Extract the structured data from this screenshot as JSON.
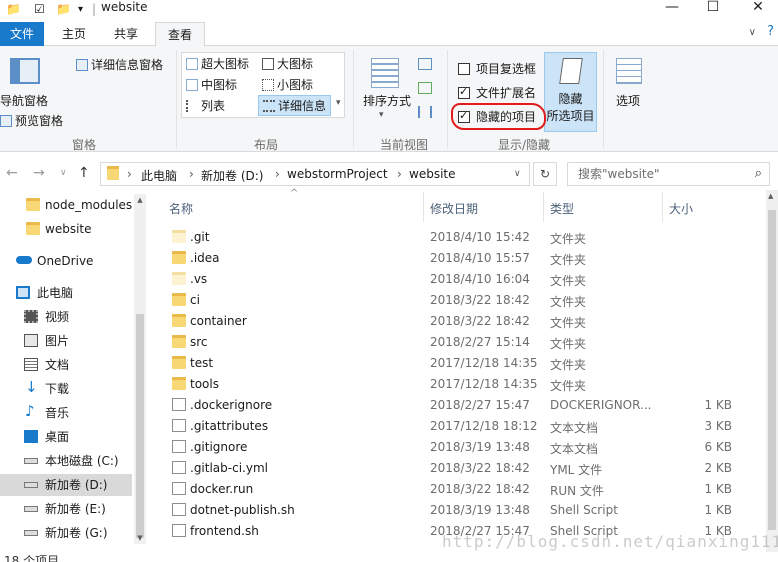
{
  "window": {
    "title": "website",
    "minimize": "—",
    "maximize": "☐",
    "close": "✕"
  },
  "tabs": [
    "文件",
    "主页",
    "共享",
    "查看"
  ],
  "ribbon": {
    "panes": {
      "nav_pane": "导航窗格",
      "preview_pane": "预览窗格",
      "details_pane": "详细信息窗格",
      "group": "窗格"
    },
    "layout": {
      "items": [
        "超大图标",
        "大图标",
        "中图标",
        "小图标",
        "列表",
        "详细信息"
      ],
      "group": "布局"
    },
    "current_view": {
      "sort_by": "排序方式",
      "group": "当前视图"
    },
    "show_hide": {
      "item_checkboxes": {
        "label": "项目复选框",
        "checked": false
      },
      "file_extensions": {
        "label": "文件扩展名",
        "checked": true
      },
      "hidden_items": {
        "label": "隐藏的项目",
        "checked": true
      },
      "hide_selected_line1": "隐藏",
      "hide_selected_line2": "所选项目",
      "group": "显示/隐藏"
    },
    "options": "选项"
  },
  "address": {
    "crumbs": [
      "此电脑",
      "新加卷 (D:)",
      "webstormProject",
      "website"
    ],
    "search_placeholder": "搜索\"website\""
  },
  "nav_pane": {
    "items": [
      {
        "label": "node_modules",
        "icon": "folder-icon"
      },
      {
        "label": "website",
        "icon": "folder-icon"
      },
      {
        "label": "OneDrive",
        "icon": "cloud-icon"
      },
      {
        "label": "此电脑",
        "icon": "computer-icon"
      },
      {
        "label": "视频",
        "icon": "video-icon"
      },
      {
        "label": "图片",
        "icon": "picture-icon"
      },
      {
        "label": "文档",
        "icon": "document-icon"
      },
      {
        "label": "下载",
        "icon": "download-icon"
      },
      {
        "label": "音乐",
        "icon": "music-icon"
      },
      {
        "label": "桌面",
        "icon": "desktop-icon"
      },
      {
        "label": "本地磁盘 (C:)",
        "icon": "drive-icon"
      },
      {
        "label": "新加卷 (D:)",
        "icon": "drive-icon"
      },
      {
        "label": "新加卷 (E:)",
        "icon": "drive-icon"
      },
      {
        "label": "新加卷 (G:)",
        "icon": "drive-icon"
      }
    ]
  },
  "file_list": {
    "columns": {
      "name": "名称",
      "date": "修改日期",
      "type": "类型",
      "size": "大小"
    },
    "rows": [
      {
        "name": ".git",
        "date": "2018/4/10 15:42",
        "type": "文件夹",
        "size": "",
        "kind": "folder-ghost"
      },
      {
        "name": ".idea",
        "date": "2018/4/10 15:57",
        "type": "文件夹",
        "size": "",
        "kind": "folder"
      },
      {
        "name": ".vs",
        "date": "2018/4/10 16:04",
        "type": "文件夹",
        "size": "",
        "kind": "folder-ghost"
      },
      {
        "name": "ci",
        "date": "2018/3/22 18:42",
        "type": "文件夹",
        "size": "",
        "kind": "folder"
      },
      {
        "name": "container",
        "date": "2018/3/22 18:42",
        "type": "文件夹",
        "size": "",
        "kind": "folder"
      },
      {
        "name": "src",
        "date": "2018/2/27 15:14",
        "type": "文件夹",
        "size": "",
        "kind": "folder"
      },
      {
        "name": "test",
        "date": "2017/12/18 14:35",
        "type": "文件夹",
        "size": "",
        "kind": "folder"
      },
      {
        "name": "tools",
        "date": "2017/12/18 14:35",
        "type": "文件夹",
        "size": "",
        "kind": "folder"
      },
      {
        "name": ".dockerignore",
        "date": "2018/2/27 15:47",
        "type": "DOCKERIGNOR...",
        "size": "1 KB",
        "kind": "file"
      },
      {
        "name": ".gitattributes",
        "date": "2017/12/18 18:12",
        "type": "文本文档",
        "size": "3 KB",
        "kind": "file"
      },
      {
        "name": ".gitignore",
        "date": "2018/3/19 13:48",
        "type": "文本文档",
        "size": "6 KB",
        "kind": "file"
      },
      {
        "name": ".gitlab-ci.yml",
        "date": "2018/3/22 18:42",
        "type": "YML 文件",
        "size": "2 KB",
        "kind": "file"
      },
      {
        "name": "docker.run",
        "date": "2018/3/22 18:42",
        "type": "RUN 文件",
        "size": "1 KB",
        "kind": "file"
      },
      {
        "name": "dotnet-publish.sh",
        "date": "2018/3/19 13:48",
        "type": "Shell Script",
        "size": "1 KB",
        "kind": "file"
      },
      {
        "name": "frontend.sh",
        "date": "2018/2/27 15:47",
        "type": "Shell Script",
        "size": "1 KB",
        "kind": "file"
      }
    ]
  },
  "status": {
    "count": "18 个项目"
  },
  "watermark": "http://blog.csdn.net/qianxing111"
}
